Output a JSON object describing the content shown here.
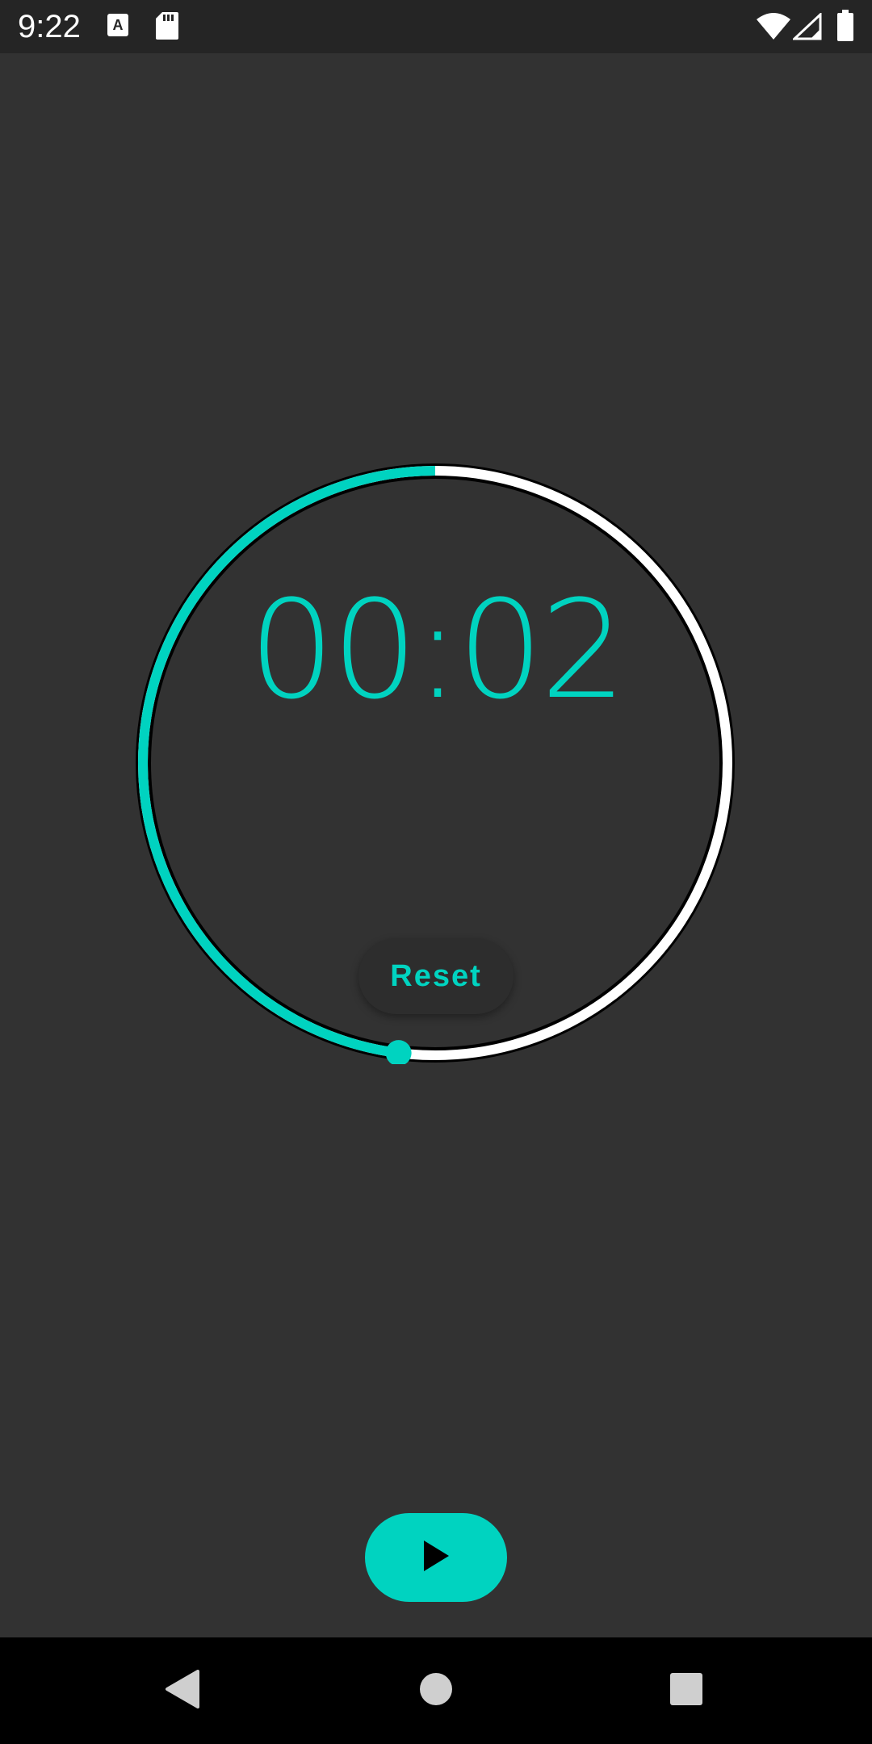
{
  "status_bar": {
    "time": "9:22",
    "icons_left": [
      "font-a-icon",
      "sd-card-icon"
    ],
    "icons_right": [
      "wifi-icon",
      "signal-icon",
      "battery-icon"
    ]
  },
  "timer": {
    "display": "00:02",
    "progress_fraction": 0.48,
    "accent_color": "#00D3C0",
    "track_color": "#FFFFFF"
  },
  "reset_button": {
    "label": "Reset"
  },
  "play_button": {
    "icon": "play-icon"
  },
  "nav_bar": {
    "buttons": [
      "back-icon",
      "home-icon",
      "recents-icon"
    ]
  },
  "colors": {
    "background": "#323232",
    "status_bar": "#252525",
    "nav_bar": "#000000",
    "accent": "#00D3C0"
  }
}
